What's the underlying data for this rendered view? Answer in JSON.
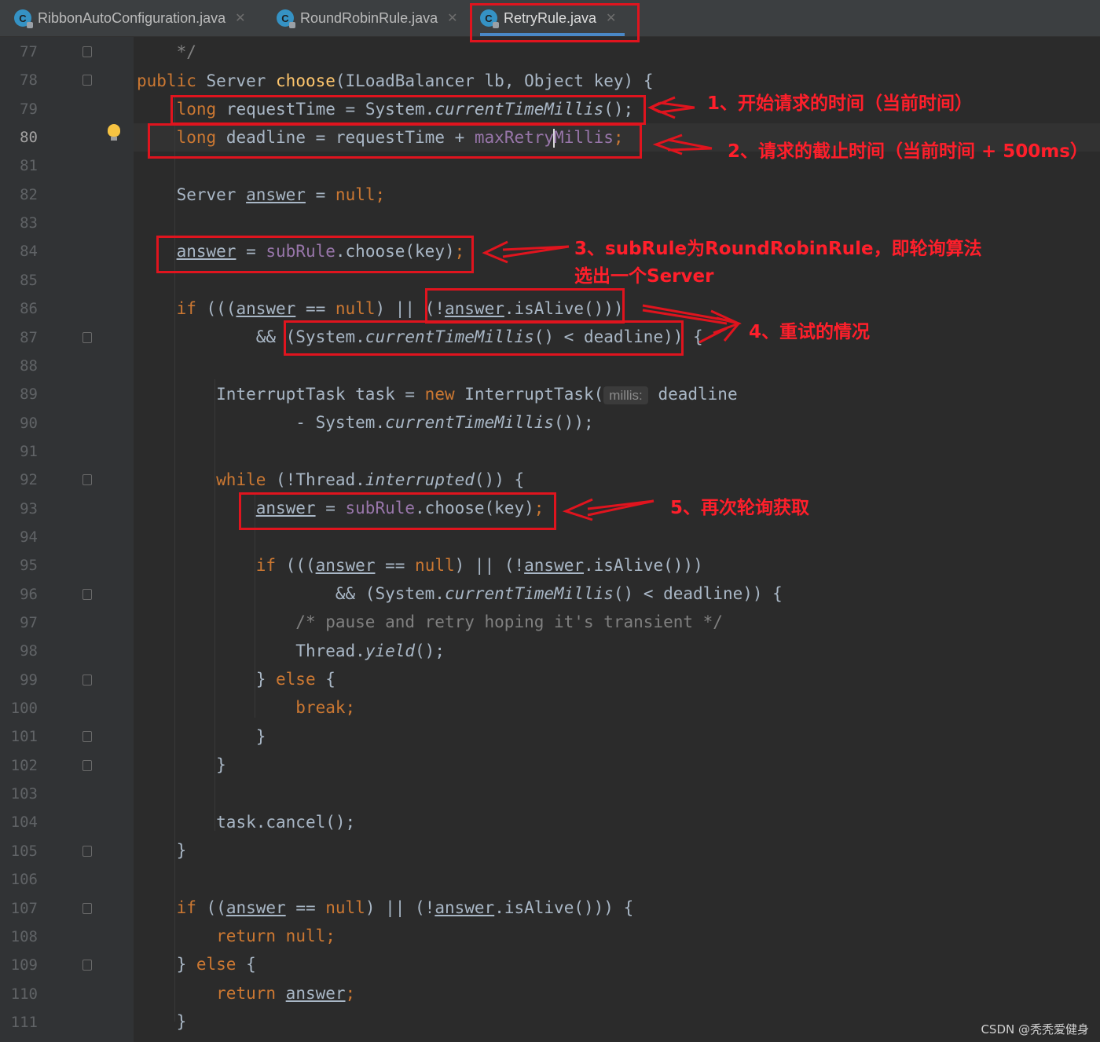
{
  "tabs": [
    {
      "label": "RibbonAutoConfiguration.java",
      "icon": "C",
      "active": false
    },
    {
      "label": "RoundRobinRule.java",
      "icon": "C",
      "active": false
    },
    {
      "label": "RetryRule.java",
      "icon": "C",
      "active": true
    }
  ],
  "line_numbers": [
    "77",
    "78",
    "79",
    "80",
    "81",
    "82",
    "83",
    "84",
    "85",
    "86",
    "87",
    "88",
    "89",
    "90",
    "91",
    "92",
    "93",
    "94",
    "95",
    "96",
    "97",
    "98",
    "99",
    "100",
    "101",
    "102",
    "103",
    "104",
    "105",
    "106",
    "107",
    "108",
    "109",
    "110",
    "111"
  ],
  "current_line": "80",
  "code": {
    "l77_comment": "*/",
    "l78_public": "public",
    "l78_type": "Server",
    "l78_method": "choose",
    "l78_params": "(ILoadBalancer lb, Object key) {",
    "kw_long": "long",
    "l79_rest": "requestTime = System.",
    "m_current": "currentTimeMillis",
    "l79_end": "();",
    "l80_rest": "deadline = requestTime + ",
    "l80_field_a": "maxRetry",
    "l80_field_b": "Millis",
    "semi": ";",
    "l82_type": "Server",
    "v_answer": "answer",
    "l82_eq": "=",
    "kw_null": "null",
    "f_subrule": "subRule",
    "choose_call": ".choose(key)",
    "kw_if": "if",
    "kw_while": "while",
    "kw_new": "new",
    "kw_else": "else",
    "kw_break": "break",
    "kw_return": "return",
    "l86_b": "(((",
    "l86_c": " == ",
    "l86_d": ") || (!",
    "l86_e": ".isAlive()))",
    "l87_a": "&& (System.",
    "l87_b": "() < deadline)) {",
    "l89_a": "InterruptTask task = ",
    "l89_b": "InterruptTask(",
    "l89_hint": "millis:",
    "l89_c": "deadline",
    "l90_a": "- System.",
    "l90_b": "());",
    "l92_a": "(!Thread.",
    "m_interrupted": "interrupted",
    "l92_b": "()) {",
    "l96_a": "&& (System.",
    "l96_b": "() < deadline)) {",
    "l97_comment": "/* pause and retry hoping it's transient */",
    "l98_a": "Thread.",
    "m_yield": "yield",
    "l98_b": "();",
    "brace_close": "}",
    "l99_a": "} ",
    "l99_b": " {",
    "l104_a": "task.cancel();",
    "l107_b": " ((",
    "l107_c": " == ",
    "l107_d": ") || (!",
    "l107_e": ".isAlive())) {",
    "l109_a": "} ",
    "l109_b": " {"
  },
  "annotations": {
    "n1": "1、开始请求的时间（当前时间）",
    "n2": "2、请求的截止时间（当前时间 + 500ms）",
    "n3_line1": "3、subRule为RoundRobinRule，即轮询算法",
    "n3_line2": "选出一个Server",
    "n4": "4、重试的情况",
    "n5": "5、再次轮询获取"
  },
  "colors": {
    "background": "#2b2b2b",
    "keyword": "#cc7832",
    "method": "#ffc66d",
    "field": "#9876aa",
    "annotation_red": "#e0141e"
  },
  "watermark": "CSDN @秃秃爱健身"
}
